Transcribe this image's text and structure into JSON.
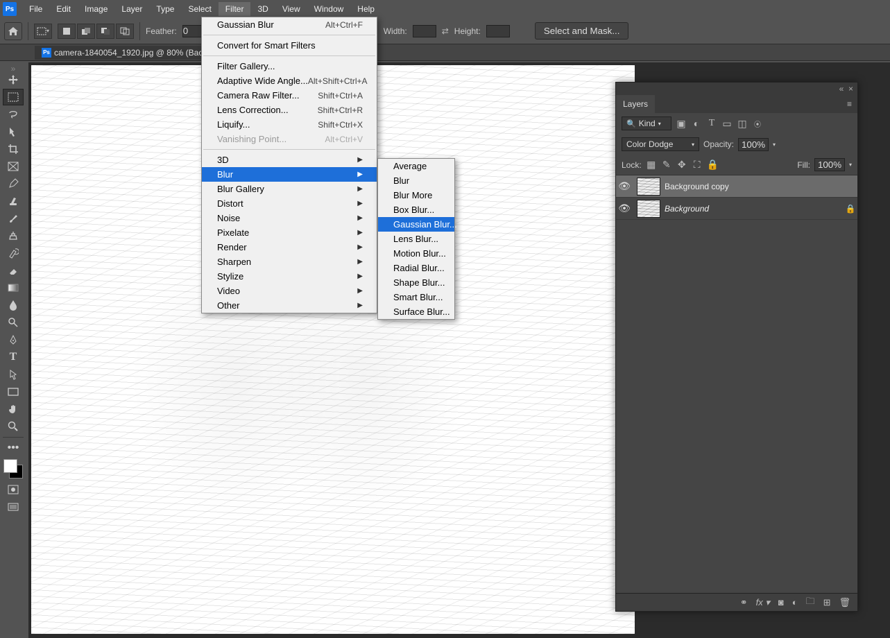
{
  "app": {
    "logo": "Ps"
  },
  "menubar": [
    "File",
    "Edit",
    "Image",
    "Layer",
    "Type",
    "Select",
    "Filter",
    "3D",
    "View",
    "Window",
    "Help"
  ],
  "menubar_open_index": 6,
  "optionsbar": {
    "feather_label": "Feather:",
    "feather_value": "0",
    "width_label": "Width:",
    "height_label": "Height:",
    "select_mask_btn": "Select and Mask..."
  },
  "document_tab": "camera-1840054_1920.jpg @ 80% (Backgr...",
  "filter_menu": {
    "top": {
      "label": "Gaussian Blur",
      "shortcut": "Alt+Ctrl+F"
    },
    "convert": "Convert for Smart Filters",
    "gallery": "Filter Gallery...",
    "adaptive": {
      "label": "Adaptive Wide Angle...",
      "shortcut": "Alt+Shift+Ctrl+A"
    },
    "raw": {
      "label": "Camera Raw Filter...",
      "shortcut": "Shift+Ctrl+A"
    },
    "lens": {
      "label": "Lens Correction...",
      "shortcut": "Shift+Ctrl+R"
    },
    "liquify": {
      "label": "Liquify...",
      "shortcut": "Shift+Ctrl+X"
    },
    "vanish": {
      "label": "Vanishing Point...",
      "shortcut": "Alt+Ctrl+V"
    },
    "groups": [
      "3D",
      "Blur",
      "Blur Gallery",
      "Distort",
      "Noise",
      "Pixelate",
      "Render",
      "Sharpen",
      "Stylize",
      "Video",
      "Other"
    ],
    "groups_hl_index": 1
  },
  "blur_submenu": {
    "items": [
      "Average",
      "Blur",
      "Blur More",
      "Box Blur...",
      "Gaussian Blur...",
      "Lens Blur...",
      "Motion Blur...",
      "Radial Blur...",
      "Shape Blur...",
      "Smart Blur...",
      "Surface Blur..."
    ],
    "hl_index": 4
  },
  "layers_panel": {
    "tab": "Layers",
    "kind_label": "Kind",
    "blend_mode": "Color Dodge",
    "opacity_label": "Opacity:",
    "opacity_value": "100%",
    "lock_label": "Lock:",
    "fill_label": "Fill:",
    "fill_value": "100%",
    "layers": [
      {
        "name": "Background copy",
        "selected": true,
        "locked": false,
        "italic": false
      },
      {
        "name": "Background",
        "selected": false,
        "locked": true,
        "italic": true
      }
    ]
  }
}
